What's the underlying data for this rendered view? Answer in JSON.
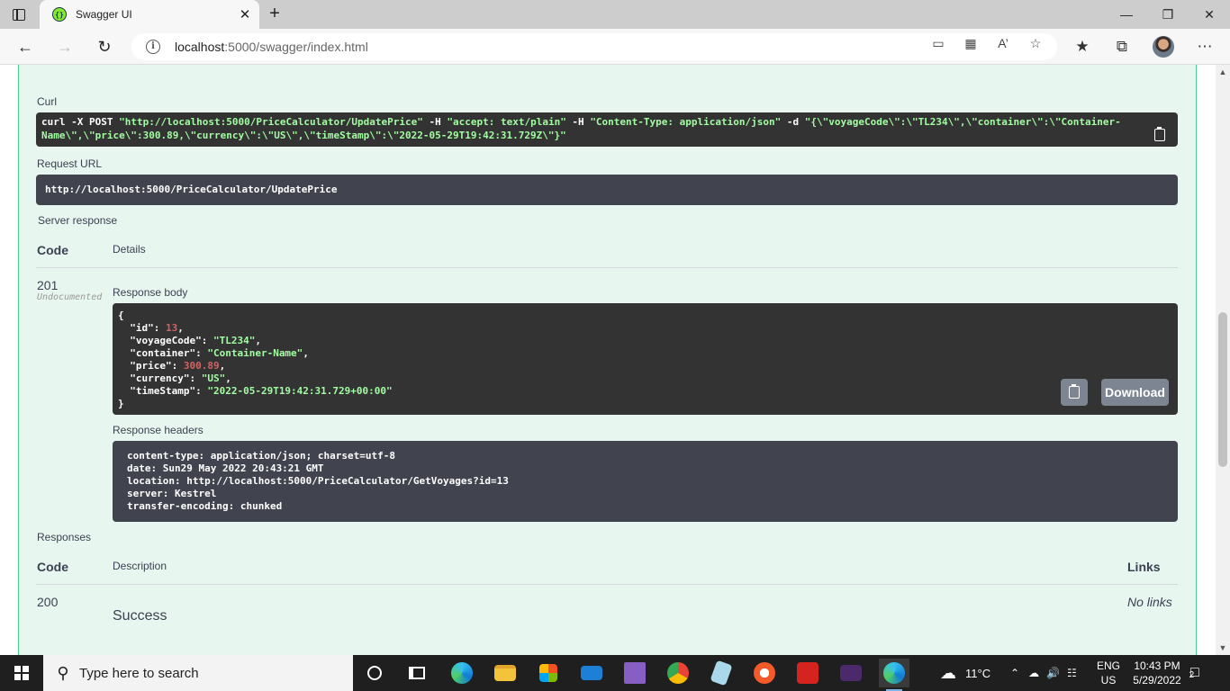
{
  "browser": {
    "tab_title": "Swagger UI",
    "url_host": "localhost",
    "url_path": ":5000/swagger/index.html",
    "new_tab": "+",
    "close": "✕"
  },
  "curl_section": {
    "label": "Curl",
    "cmd_1": "curl -X POST ",
    "cmd_url": "\"http://localhost:5000/PriceCalculator/UpdatePrice\"",
    "cmd_h1": " -H  ",
    "cmd_accept": "\"accept: text/plain\"",
    "cmd_h2": " -H  ",
    "cmd_ct": "\"Content-Type: application/json\"",
    "cmd_d": " -d ",
    "cmd_body_1": "\"{\\\"voyageCode\\\":\\\"TL234\\\",\\\"container\\\":\\\"Container-",
    "cmd_body_2": "Name\\\",\\\"price\\\":300.89,\\\"currency\\\":\\\"US\\\",\\\"timeStamp\\\":\\\"2022-05-29T19:42:31.729Z\\\"}\""
  },
  "request_url": {
    "label": "Request URL",
    "value": "http://localhost:5000/PriceCalculator/UpdatePrice"
  },
  "server_response": {
    "label": "Server response",
    "col_code": "Code",
    "col_details": "Details",
    "code": "201",
    "code_note": "Undocumented",
    "body_label": "Response body",
    "body": {
      "open": "{",
      "close": "}",
      "id_key": "  \"id\": ",
      "id_val": "13",
      "voyage_key": "  \"voyageCode\": ",
      "voyage_val": "\"TL234\"",
      "container_key": "  \"container\": ",
      "container_val": "\"Container-Name\"",
      "price_key": "  \"price\": ",
      "price_val": "300.89",
      "currency_key": "  \"currency\": ",
      "currency_val": "\"US\"",
      "ts_key": "  \"timeStamp\": ",
      "ts_val": "\"2022-05-29T19:42:31.729+00:00\"",
      "comma": ","
    },
    "download_label": "Download",
    "headers_label": "Response headers",
    "headers": [
      "content-type: application/json; charset=utf-8",
      "date: Sun29 May 2022 20:43:21 GMT",
      "location: http://localhost:5000/PriceCalculator/GetVoyages?id=13",
      "server: Kestrel",
      "transfer-encoding: chunked"
    ]
  },
  "responses": {
    "label": "Responses",
    "col_code": "Code",
    "col_description": "Description",
    "col_links": "Links",
    "rows": [
      {
        "code": "200",
        "description": "Success",
        "links": "No links"
      }
    ]
  },
  "taskbar": {
    "search_placeholder": "Type here to search",
    "weather": "11°C",
    "lang_1": "ENG",
    "lang_2": "US",
    "time": "10:43 PM",
    "date": "5/29/2022",
    "notifications": "2"
  },
  "colors": {
    "accent_green": "#49cc90",
    "code_bg": "#333333",
    "string_green": "#a2fca2",
    "number_red": "#d36363"
  }
}
